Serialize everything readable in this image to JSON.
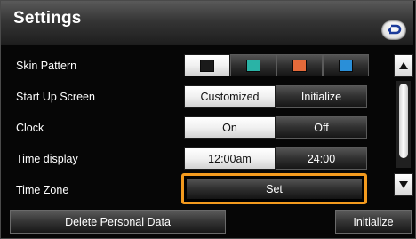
{
  "header": {
    "title": "Settings",
    "back_icon": "return-arrow-icon"
  },
  "rows": {
    "skin_pattern": {
      "label": "Skin Pattern",
      "swatches": [
        {
          "name": "black",
          "color": "#1a1a1a",
          "selected": true
        },
        {
          "name": "teal",
          "color": "#2ab3a6",
          "selected": false
        },
        {
          "name": "orange",
          "color": "#e56a3a",
          "selected": false
        },
        {
          "name": "blue",
          "color": "#2a8fd8",
          "selected": false
        }
      ]
    },
    "start_up_screen": {
      "label": "Start Up Screen",
      "options": [
        "Customized",
        "Initialize"
      ],
      "selected": "Customized"
    },
    "clock": {
      "label": "Clock",
      "options": [
        "On",
        "Off"
      ],
      "selected": "On"
    },
    "time_display": {
      "label": "Time display",
      "options": [
        "12:00am",
        "24:00"
      ],
      "selected": "12:00am"
    },
    "time_zone": {
      "label": "Time Zone",
      "button": "Set"
    }
  },
  "footer": {
    "delete_label": "Delete Personal Data",
    "initialize_label": "Initialize"
  },
  "colors": {
    "focus": "#f39a1e"
  }
}
